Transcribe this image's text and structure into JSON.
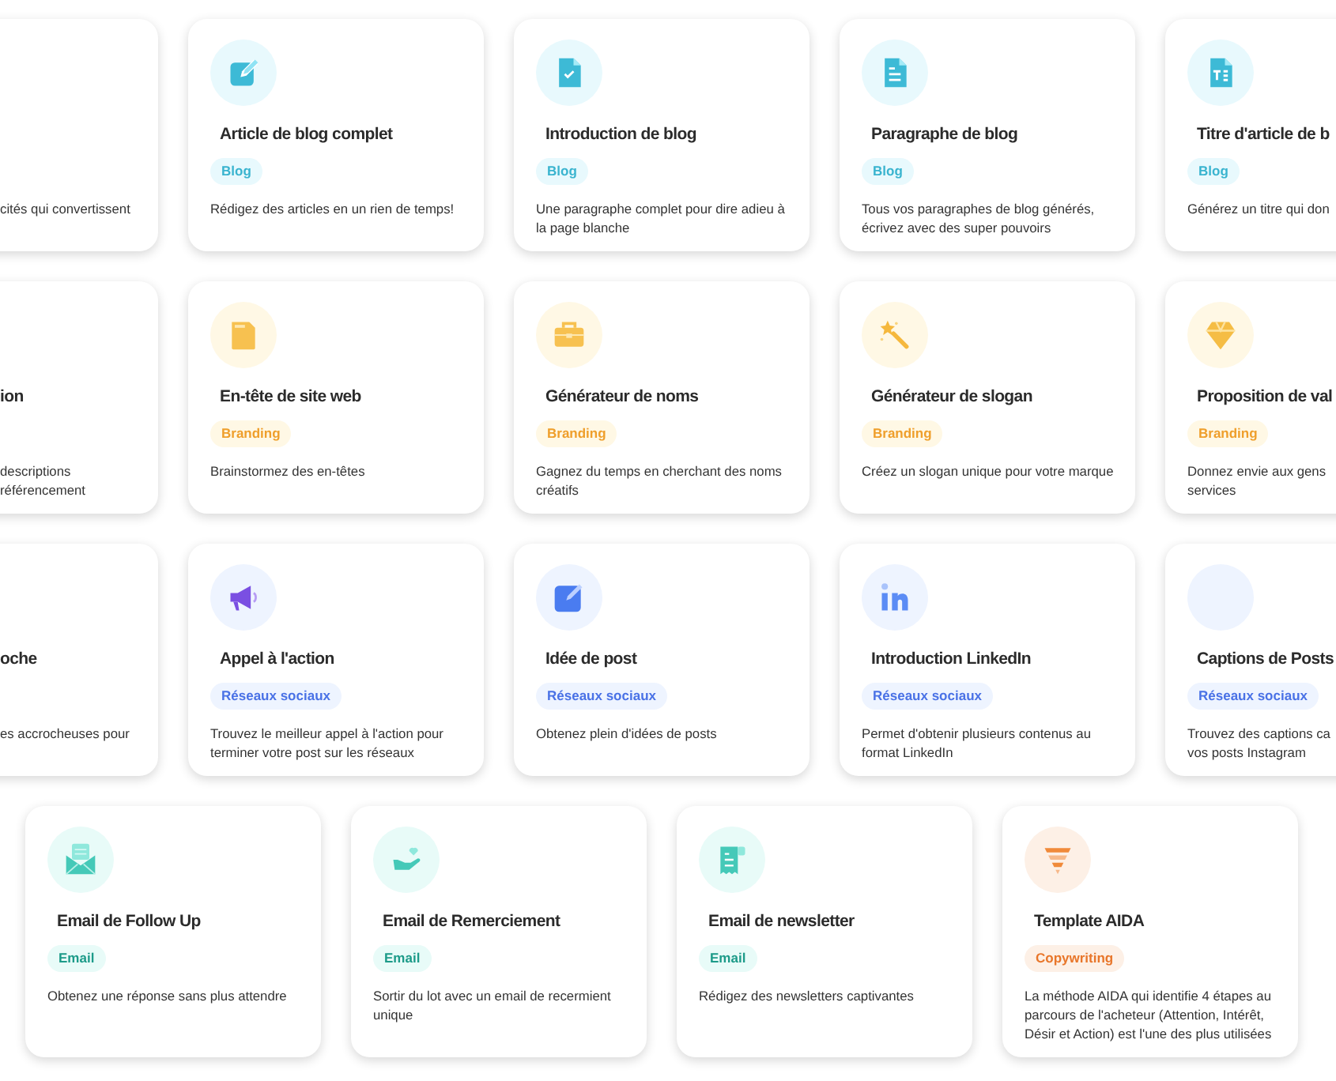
{
  "rows": [
    {
      "cards": [
        {
          "description": "cités qui convertissent"
        },
        {
          "title": "Article de blog complet",
          "category": {
            "kind": "blog",
            "label": "Blog"
          },
          "description": "Rédigez des articles en un rien de temps!"
        },
        {
          "title": "Introduction de blog",
          "category": {
            "kind": "blog",
            "label": "Blog"
          },
          "description": "Une paragraphe complet pour dire adieu à la page blanche"
        },
        {
          "title": "Paragraphe de blog",
          "category": {
            "kind": "blog",
            "label": "Blog"
          },
          "description": "Tous vos paragraphes de blog générés, écrivez avec des super pouvoirs"
        },
        {
          "title": "Titre d'article de b",
          "category": {
            "kind": "blog",
            "label": "Blog"
          },
          "description": "Générez un titre qui don"
        }
      ]
    },
    {
      "cards": [
        {
          "title": "ion",
          "description": "descriptions\nréférencement"
        },
        {
          "title": "En-tête de site web",
          "category": {
            "kind": "branding",
            "label": "Branding"
          },
          "description": "Brainstormez des en-têtes"
        },
        {
          "title": "Générateur de noms",
          "category": {
            "kind": "branding",
            "label": "Branding"
          },
          "description": "Gagnez du temps en cherchant des noms créatifs"
        },
        {
          "title": "Générateur de slogan",
          "category": {
            "kind": "branding",
            "label": "Branding"
          },
          "description": "Créez un slogan unique pour votre marque"
        },
        {
          "title": "Proposition de val",
          "category": {
            "kind": "branding",
            "label": "Branding"
          },
          "description": "Donnez envie aux gens\nservices"
        }
      ]
    },
    {
      "cards": [
        {
          "title": "oche",
          "description": "es accrocheuses pour"
        },
        {
          "title": "Appel à l'action",
          "category": {
            "kind": "social",
            "label": "Réseaux sociaux"
          },
          "description": "Trouvez le meilleur appel à l'action pour terminer votre post sur les réseaux"
        },
        {
          "title": "Idée de post",
          "category": {
            "kind": "social",
            "label": "Réseaux sociaux"
          },
          "description": "Obtenez plein d'idées de posts"
        },
        {
          "title": "Introduction LinkedIn",
          "category": {
            "kind": "social",
            "label": "Réseaux sociaux"
          },
          "description": "Permet d'obtenir plusieurs contenus au format LinkedIn"
        },
        {
          "title": "Captions de Posts",
          "category": {
            "kind": "social",
            "label": "Réseaux sociaux"
          },
          "description": "Trouvez des captions ca\nvos posts Instagram"
        }
      ]
    },
    {
      "cards": [
        {
          "title": "Email de Follow Up",
          "category": {
            "kind": "email",
            "label": "Email"
          },
          "description": "Obtenez une réponse sans plus attendre"
        },
        {
          "title": "Email de Remerciement",
          "category": {
            "kind": "email",
            "label": "Email"
          },
          "description": "Sortir du lot avec un email de recermient unique"
        },
        {
          "title": "Email de newsletter",
          "category": {
            "kind": "email",
            "label": "Email"
          },
          "description": "Rédigez des newsletters captivantes"
        },
        {
          "title": "Template AIDA",
          "category": {
            "kind": "copywriting",
            "label": "Copywriting"
          },
          "description": "La méthode AIDA qui identifie 4 étapes au parcours de l'acheteur (Attention, Intérêt, Désir et Action) est l'une des plus utilisées"
        }
      ]
    }
  ]
}
